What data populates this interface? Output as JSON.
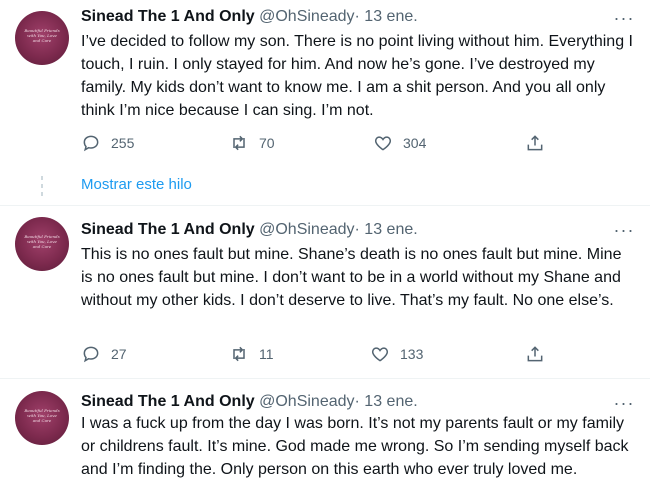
{
  "tweets": [
    {
      "avatar_text": "Beautiful Friends with You, Love and Care",
      "name": "Sinead The 1 And Only",
      "handle": "@OhSineady",
      "sep": "·",
      "date": "13 ene.",
      "text": "I’ve decided to follow my son. There is no point living without him. Everything I touch, I ruin.  I only stayed for him. And now he’s gone. I’ve destroyed my family. My kids don’t want to know me.  I am a shit person. And you all only think I’m nice because I can sing. I’m not.",
      "replies": "255",
      "retweets": "70",
      "likes": "304"
    },
    {
      "avatar_text": "Beautiful Friends with You, Love and Care",
      "name": "Sinead The 1 And Only",
      "handle": "@OhSineady",
      "sep": "·",
      "date": "13 ene.",
      "text": "This is no ones fault but mine. Shane’s death is no ones fault but mine. Mine is no ones fault but mine. I don’t want to be in a world without my Shane and without my other kids. I don’t deserve to live. That’s my fault. No one else’s.",
      "replies": "27",
      "retweets": "11",
      "likes": "133"
    },
    {
      "avatar_text": "Beautiful Friends with You, Love and Care",
      "name": "Sinead The 1 And Only",
      "handle": "@OhSineady",
      "sep": "·",
      "date": "13 ene.",
      "text": "I was a fuck up from the day I was born. It’s not my parents fault or my family or childrens  fault. It’s mine. God made me wrong. So I’m sending myself back and I’m finding the. Only person on this earth who ever truly loved me."
    }
  ],
  "show_thread": "Mostrar este hilo",
  "more_label": "···",
  "colors": {
    "link": "#1d9bf0",
    "secondary": "#536471",
    "divider": "#eff3f4"
  }
}
